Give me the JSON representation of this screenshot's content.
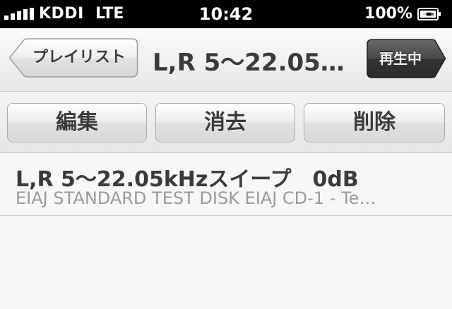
{
  "status_bar": {
    "carrier": "KDDI",
    "network": "LTE",
    "time": "10:42",
    "battery": "100%",
    "signal_icon": "signal-bars-icon",
    "battery_icon": "battery-charging-icon"
  },
  "nav": {
    "back_label": "プレイリスト",
    "title": "L,R 5〜22.05…",
    "now_playing_label": "再生中"
  },
  "toolbar": {
    "edit_label": "編集",
    "clear_label": "消去",
    "delete_label": "削除"
  },
  "tracks": [
    {
      "title": "L,R 5〜22.05kHzスイープ　0dB",
      "subtitle": "EIAJ STANDARD TEST DISK EIAJ CD-1 - Te…"
    }
  ],
  "colors": {
    "status_bar_bg": "#000000",
    "now_playing_button": "#3a3a3a",
    "title_text": "#3a3a3a",
    "subtitle_text": "#9a9a9a"
  }
}
